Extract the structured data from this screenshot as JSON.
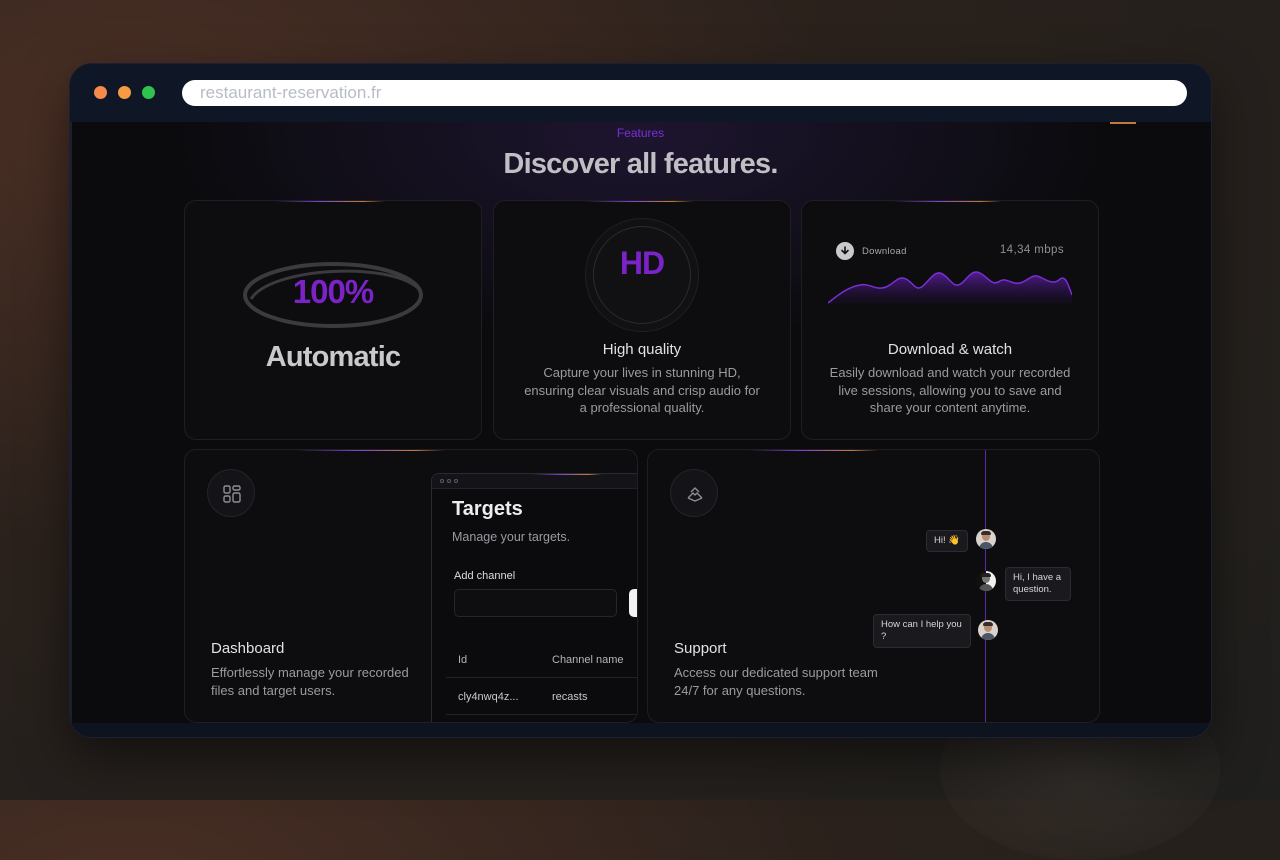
{
  "browser": {
    "url": "restaurant-reservation.fr"
  },
  "header": {
    "eyebrow": "Features",
    "title": "Discover all features."
  },
  "cards": {
    "automatic": {
      "badge": "100%",
      "title": "Automatic"
    },
    "quality": {
      "badge": "HD",
      "title": "High quality",
      "description": "Capture your lives in stunning HD, ensuring clear visuals and crisp audio for a professional quality."
    },
    "download": {
      "label": "Download",
      "speed": "14,34 mbps",
      "title": "Download & watch",
      "description": "Easily download and watch your recorded live sessions, allowing you to save and share your content anytime."
    },
    "dashboard": {
      "title": "Dashboard",
      "description": "Effortlessly manage your recorded files and target users.",
      "mock": {
        "title": "Targets",
        "subtitle": "Manage your targets.",
        "field_label": "Add channel",
        "columns": [
          "Id",
          "Channel name"
        ],
        "rows": [
          {
            "id": "cly4nwq4z...",
            "channel": "recasts"
          }
        ]
      }
    },
    "support": {
      "title": "Support",
      "description": "Access our dedicated support team 24/7 for any questions.",
      "messages": [
        {
          "text": "Hi! 👋"
        },
        {
          "text": "Hi, I have a question."
        },
        {
          "text": "How can I help you ?"
        }
      ]
    }
  },
  "colors": {
    "accent_purple": "#7b23c8",
    "accent_orange": "#c27a3a",
    "card_bg": "#0d0d0f"
  }
}
